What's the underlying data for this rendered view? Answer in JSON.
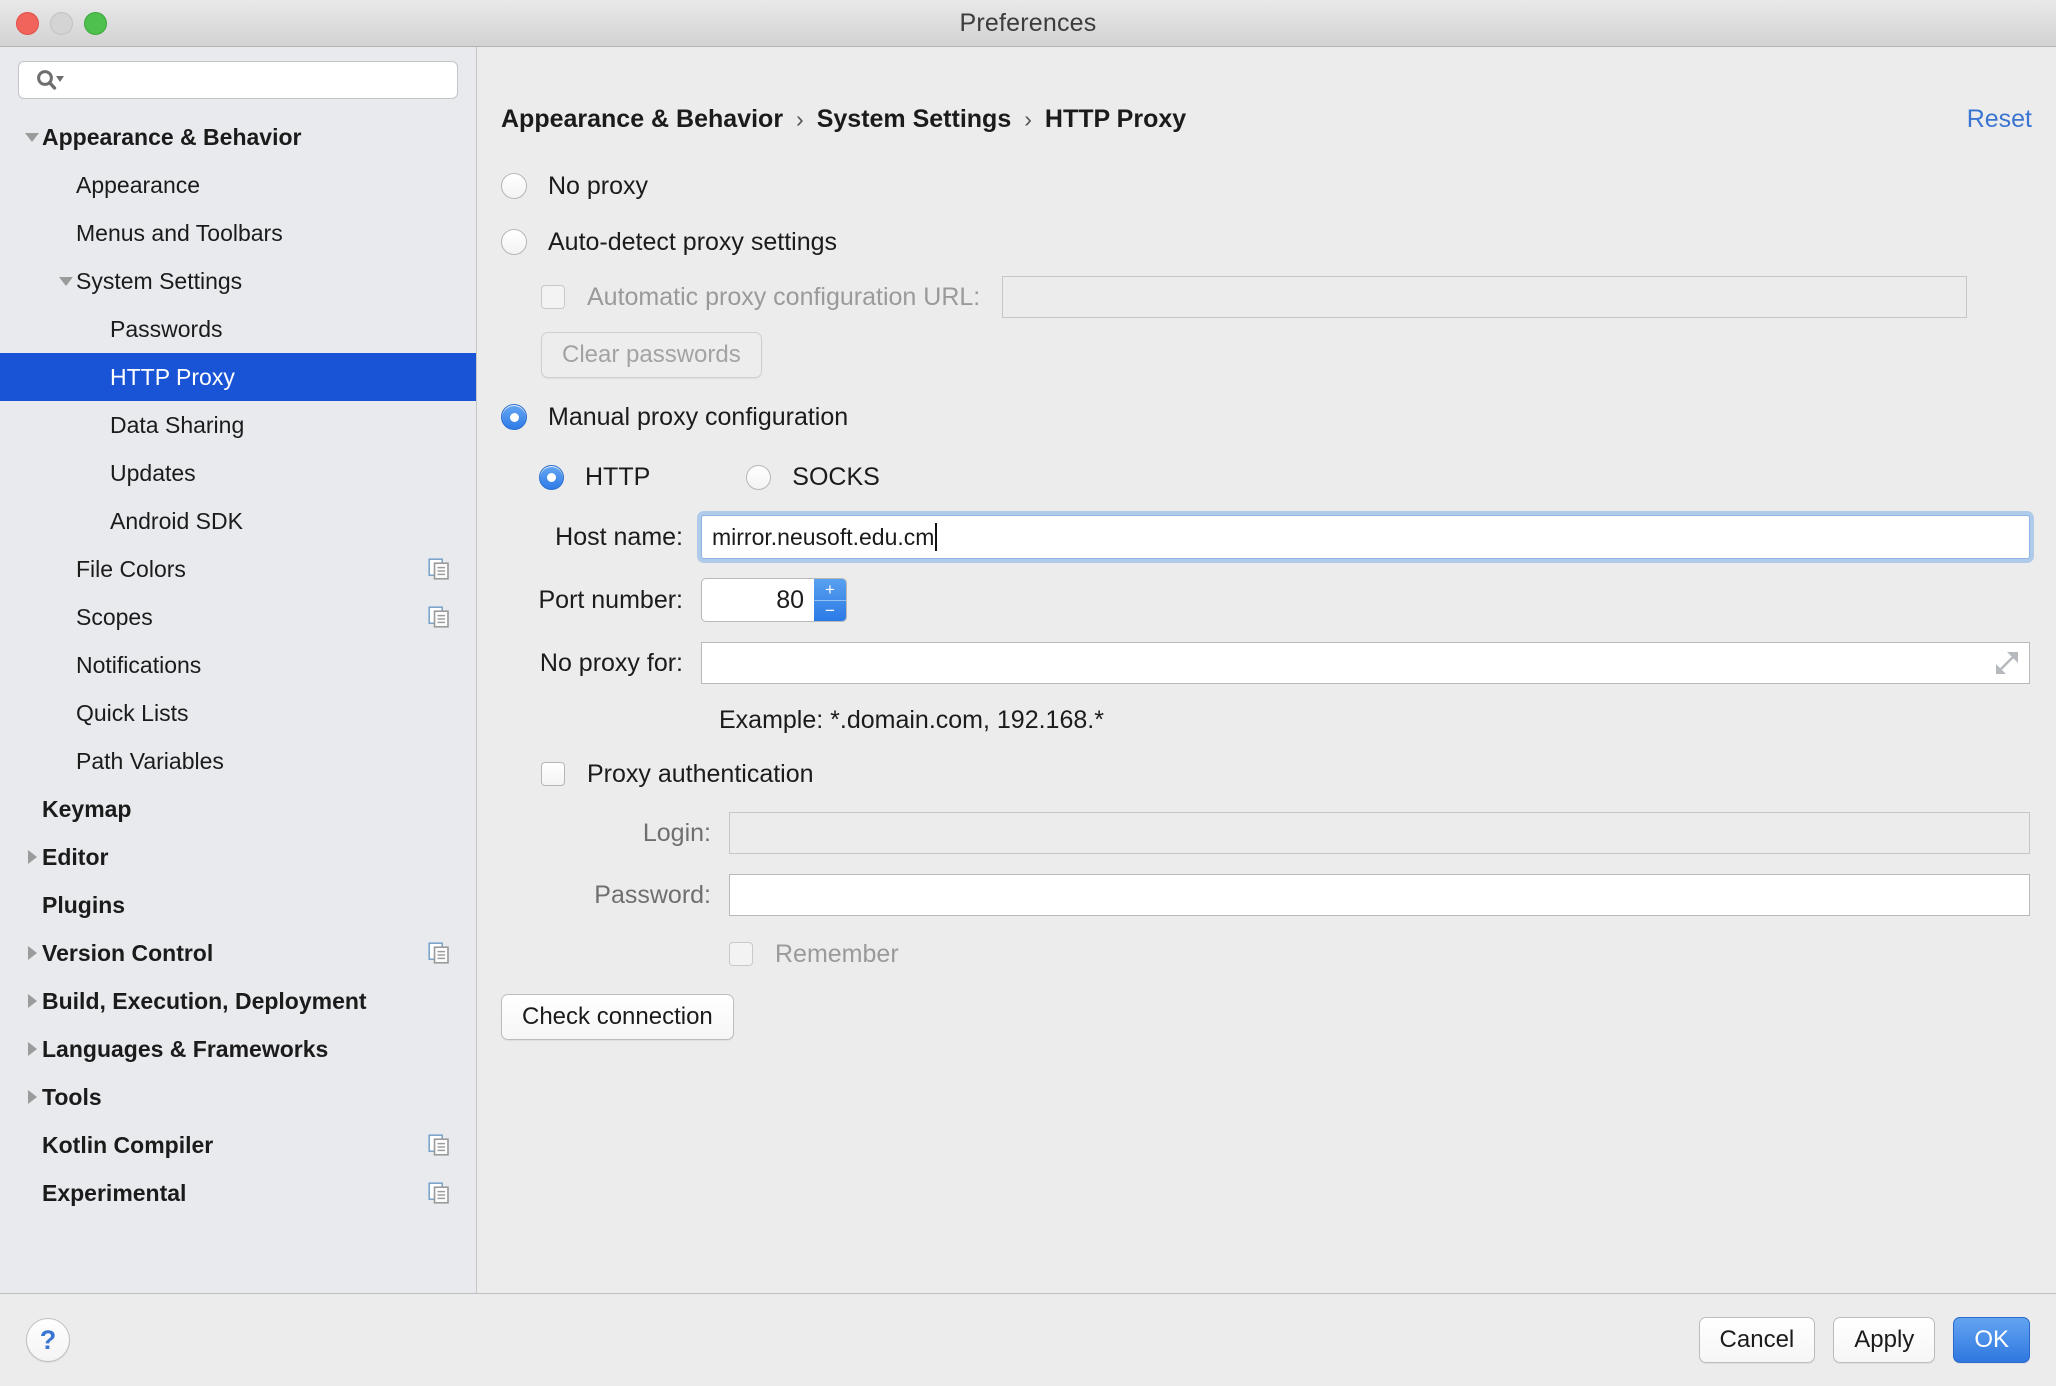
{
  "window": {
    "title": "Preferences"
  },
  "search": {
    "value": "",
    "placeholder": "",
    "icon": "search-icon"
  },
  "sidebar": {
    "items": [
      {
        "label": "Appearance & Behavior",
        "indent": 0,
        "twisty": "down",
        "bold": true,
        "selected": false,
        "copy": false
      },
      {
        "label": "Appearance",
        "indent": 1,
        "twisty": "none",
        "bold": false,
        "selected": false,
        "copy": false
      },
      {
        "label": "Menus and Toolbars",
        "indent": 1,
        "twisty": "none",
        "bold": false,
        "selected": false,
        "copy": false
      },
      {
        "label": "System Settings",
        "indent": 1,
        "twisty": "down",
        "bold": false,
        "selected": false,
        "copy": false
      },
      {
        "label": "Passwords",
        "indent": 2,
        "twisty": "none",
        "bold": false,
        "selected": false,
        "copy": false
      },
      {
        "label": "HTTP Proxy",
        "indent": 2,
        "twisty": "none",
        "bold": false,
        "selected": true,
        "copy": false
      },
      {
        "label": "Data Sharing",
        "indent": 2,
        "twisty": "none",
        "bold": false,
        "selected": false,
        "copy": false
      },
      {
        "label": "Updates",
        "indent": 2,
        "twisty": "none",
        "bold": false,
        "selected": false,
        "copy": false
      },
      {
        "label": "Android SDK",
        "indent": 2,
        "twisty": "none",
        "bold": false,
        "selected": false,
        "copy": false
      },
      {
        "label": "File Colors",
        "indent": 1,
        "twisty": "none",
        "bold": false,
        "selected": false,
        "copy": true
      },
      {
        "label": "Scopes",
        "indent": 1,
        "twisty": "none",
        "bold": false,
        "selected": false,
        "copy": true
      },
      {
        "label": "Notifications",
        "indent": 1,
        "twisty": "none",
        "bold": false,
        "selected": false,
        "copy": false
      },
      {
        "label": "Quick Lists",
        "indent": 1,
        "twisty": "none",
        "bold": false,
        "selected": false,
        "copy": false
      },
      {
        "label": "Path Variables",
        "indent": 1,
        "twisty": "none",
        "bold": false,
        "selected": false,
        "copy": false
      },
      {
        "label": "Keymap",
        "indent": 0,
        "twisty": "none",
        "bold": true,
        "selected": false,
        "copy": false
      },
      {
        "label": "Editor",
        "indent": 0,
        "twisty": "right",
        "bold": true,
        "selected": false,
        "copy": false
      },
      {
        "label": "Plugins",
        "indent": 0,
        "twisty": "none",
        "bold": true,
        "selected": false,
        "copy": false
      },
      {
        "label": "Version Control",
        "indent": 0,
        "twisty": "right",
        "bold": true,
        "selected": false,
        "copy": true
      },
      {
        "label": "Build, Execution, Deployment",
        "indent": 0,
        "twisty": "right",
        "bold": true,
        "selected": false,
        "copy": false
      },
      {
        "label": "Languages & Frameworks",
        "indent": 0,
        "twisty": "right",
        "bold": true,
        "selected": false,
        "copy": false
      },
      {
        "label": "Tools",
        "indent": 0,
        "twisty": "right",
        "bold": true,
        "selected": false,
        "copy": false
      },
      {
        "label": "Kotlin Compiler",
        "indent": 0,
        "twisty": "none",
        "bold": true,
        "selected": false,
        "copy": true
      },
      {
        "label": "Experimental",
        "indent": 0,
        "twisty": "none",
        "bold": true,
        "selected": false,
        "copy": true
      }
    ]
  },
  "header": {
    "crumb1": "Appearance & Behavior",
    "crumb2": "System Settings",
    "crumb3": "HTTP Proxy",
    "separator": "›",
    "reset_label": "Reset"
  },
  "form": {
    "no_proxy_label": "No proxy",
    "no_proxy_selected": false,
    "auto_detect_label": "Auto-detect proxy settings",
    "auto_detect_selected": false,
    "pac_url_label": "Automatic proxy configuration URL:",
    "pac_url_value": "",
    "pac_url_checked": false,
    "clear_passwords_label": "Clear passwords",
    "manual_label": "Manual proxy configuration",
    "manual_selected": true,
    "http_label": "HTTP",
    "http_selected": true,
    "socks_label": "SOCKS",
    "socks_selected": false,
    "host_label": "Host name:",
    "host_value": "mirror.neusoft.edu.cm",
    "port_label": "Port number:",
    "port_value": "80",
    "spinner_up": "+",
    "spinner_down": "−",
    "no_proxy_for_label": "No proxy for:",
    "no_proxy_for_value": "",
    "expand_icon": "expand-icon",
    "example_text": "Example: *.domain.com, 192.168.*",
    "proxy_auth_label": "Proxy authentication",
    "proxy_auth_checked": false,
    "login_label": "Login:",
    "login_value": "",
    "password_label": "Password:",
    "password_value": "",
    "remember_label": "Remember",
    "remember_checked": false,
    "check_connection_label": "Check connection"
  },
  "footer": {
    "help_label": "?",
    "cancel_label": "Cancel",
    "apply_label": "Apply",
    "ok_label": "OK"
  },
  "colors": {
    "selection_blue": "#1a54d6",
    "link_blue": "#3a76d1",
    "accent_blue": "#2f7ce8",
    "sidebar_bg": "#e8eaee",
    "content_bg": "#ececec"
  }
}
